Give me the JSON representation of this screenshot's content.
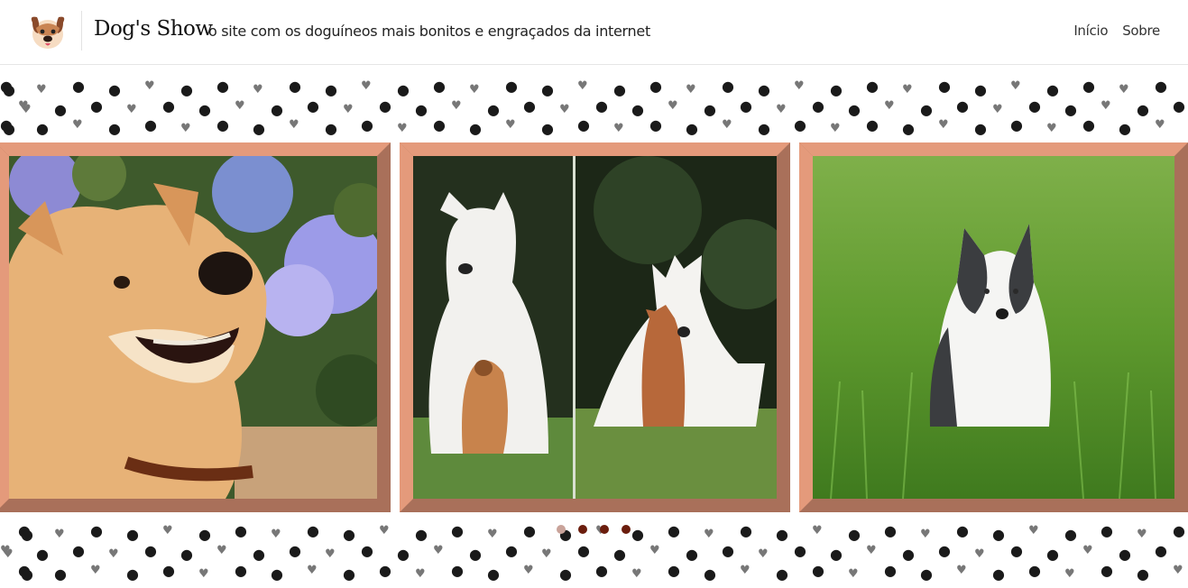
{
  "header": {
    "brand": "Dog's Show",
    "tagline": "o site com os doguíneos mais bonitos e engraçados da internet",
    "logo_icon": "dog-face-icon"
  },
  "nav": {
    "items": [
      {
        "label": "Início"
      },
      {
        "label": "Sobre"
      }
    ]
  },
  "carousel": {
    "slides": [
      {
        "subject": "shiba-inu-with-hydrangeas"
      },
      {
        "subject": "white-shepherd-with-puppy-diptych"
      },
      {
        "subject": "husky-puppy-in-grass"
      }
    ],
    "indicators": 4,
    "active_index": 0
  },
  "colors": {
    "frame": "#a9705a",
    "frame_light": "#e49a7b",
    "dot": "#6b1d0d",
    "dot_active": "#c9a39a"
  },
  "background_icon": "paw-print-icon"
}
